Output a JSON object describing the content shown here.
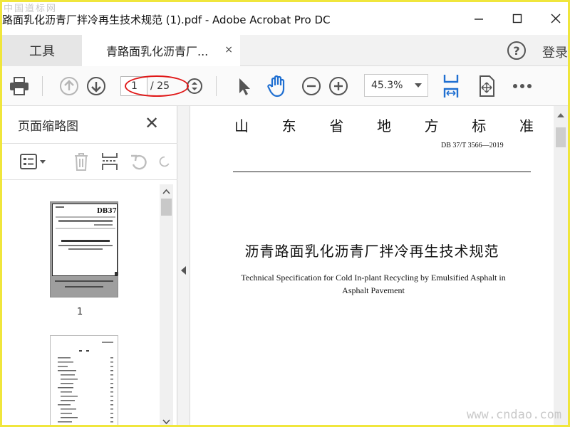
{
  "window": {
    "title": "路面乳化沥青厂拌冷再生技术规范 (1).pdf - Adobe Acrobat Pro DC",
    "watermark_top": "中国道标网",
    "watermark_bottom": "www.cndao.com"
  },
  "tabs": {
    "tools_label": "工具",
    "doc_label": "青路面乳化沥青厂...",
    "doc_close": "×",
    "login_label": "登录",
    "help_glyph": "?"
  },
  "toolbar": {
    "current_page": "1",
    "page_total": "/ 25",
    "zoom": "45.3%"
  },
  "thumbnail_panel": {
    "title": "页面缩略图",
    "close_glyph": "✕",
    "page1_label": "1"
  },
  "document": {
    "heading_chars": [
      "山",
      "东",
      "省",
      "地",
      "方",
      "标",
      "准"
    ],
    "std_number": "DB 37/T  3566—2019",
    "title_cn": "沥青路面乳化沥青厂拌冷再生技术规范",
    "title_en": "Technical Specification for Cold In-plant Recycling by Emulsified Asphalt in Asphalt Pavement"
  },
  "colors": {
    "accent_blue": "#1f6fd1",
    "annotation_red": "#e01818",
    "frame_yellow": "#f0e63c"
  }
}
